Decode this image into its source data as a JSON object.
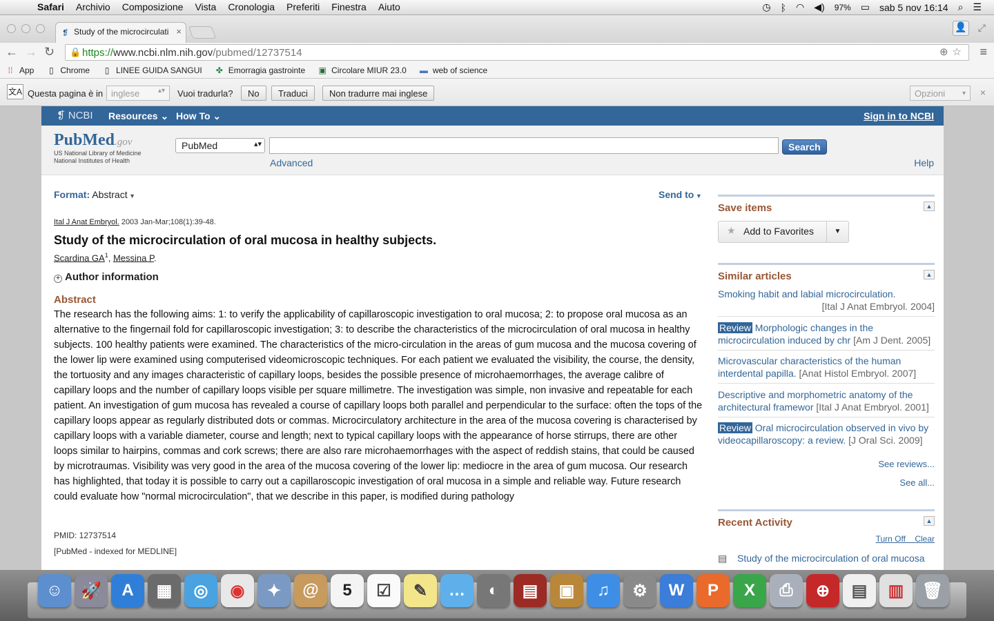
{
  "menubar": {
    "app": "Safari",
    "items": [
      "Archivio",
      "Composizione",
      "Vista",
      "Cronologia",
      "Preferiti",
      "Finestra",
      "Aiuto"
    ],
    "battery": "97%",
    "datetime": "sab 5 nov  16:14"
  },
  "browser": {
    "tab_title": "Study of the microcirculati",
    "url_scheme": "https://",
    "url_host": "www.ncbi.nlm.nih.gov",
    "url_path": "/pubmed/12737514"
  },
  "bookmarks": [
    {
      "label": "App",
      "icon": "apps-grid-icon"
    },
    {
      "label": "Chrome",
      "icon": "page-icon"
    },
    {
      "label": "LINEE GUIDA SANGUI",
      "icon": "page-icon"
    },
    {
      "label": "Emorragia gastrointe",
      "icon": "site-icon"
    },
    {
      "label": "Circolare MIUR 23.0",
      "icon": "site-icon"
    },
    {
      "label": "web of science",
      "icon": "folder-icon"
    }
  ],
  "translate": {
    "prefix": "Questa pagina è in",
    "language": "inglese",
    "question": "Vuoi tradurla?",
    "no": "No",
    "translate_btn": "Traduci",
    "never": "Non tradurre mai inglese",
    "options": "Opzioni"
  },
  "ncbi": {
    "logo": "NCBI",
    "resources": "Resources",
    "howto": "How To",
    "signin": "Sign in to NCBI"
  },
  "search": {
    "logo_main": "PubMed",
    "logo_gov": ".gov",
    "logo_sub1": "US National Library of Medicine",
    "logo_sub2": "National Institutes of Health",
    "db": "PubMed",
    "button": "Search",
    "advanced": "Advanced",
    "help": "Help"
  },
  "article": {
    "format_label": "Format:",
    "format_value": "Abstract",
    "send_to": "Send to",
    "journal": "Ital J Anat Embryol.",
    "citation": " 2003 Jan-Mar;108(1):39-48.",
    "title": "Study of the microcirculation of oral mucosa in healthy subjects.",
    "author1": "Scardina GA",
    "author1_sup": "1",
    "author2": "Messina P",
    "author_info": "Author information",
    "abstract_heading": "Abstract",
    "abstract": "The research has the following aims: 1: to verify the applicability of capillaroscopic investigation to oral mucosa; 2: to propose oral mucosa as an alternative to the fingernail fold for capillaroscopic investigation; 3: to describe the characteristics of the microcirculation of oral mucosa in healthy subjects. 100 healthy patients were examined. The characteristics of the micro-circulation in the areas of gum mucosa and the mucosa covering of the lower lip were examined using computerised videomicroscopic techniques. For each patient we evaluated the visibility, the course, the density, the tortuosity and any images characteristic of capillary loops, besides the possible presence of microhaemorrhages, the average calibre of capillary loops and the number of capillary loops visible per square millimetre. The investigation was simple, non invasive and repeatable for each patient. An investigation of gum mucosa has revealed a course of capillary loops both parallel and perpendicular to the surface: often the tops of the capillary loops appear as regularly distributed dots or commas. Microcirculatory architecture in the area of the mucosa covering is characterised by capillary loops with a variable diameter, course and length; next to typical capillary loops with the appearance of horse stirrups, there are other loops similar to hairpins, commas and cork screws; there are also rare microhaemorrhages with the aspect of reddish stains, that could be caused by microtraumas. Visibility was very good in the area of the mucosa covering of the lower lip: mediocre in the area of gum mucosa. Our research has highlighted, that today it is possible to carry out a capillaroscopic investigation of oral mucosa in a simple and reliable way. Future research could evaluate how \"normal microcirculation\", that we describe in this paper, is modified during pathology",
    "pmid": "PMID: 12737514",
    "indexed": "[PubMed - indexed for MEDLINE]"
  },
  "sidebar": {
    "save_heading": "Save items",
    "add_fav": "Add to Favorites",
    "similar_heading": "Similar articles",
    "similar": [
      {
        "badge": "",
        "title": "Smoking habit and labial microcirculation.",
        "source": "[Ital J Anat Embryol. 2004]"
      },
      {
        "badge": "Review",
        "title": " Morphologic changes in the microcirculation induced by chr",
        "source": "[Am J Dent. 2005]"
      },
      {
        "badge": "",
        "title": "Microvascular characteristics of the human interdental papilla.",
        "source": "[Anat Histol Embryol. 2007]"
      },
      {
        "badge": "",
        "title": "Descriptive and morphometric anatomy of the architectural framewor",
        "source": "[Ital J Anat Embryol. 2001]"
      },
      {
        "badge": "Review",
        "title": " Oral microcirculation observed in vivo by videocapillaroscopy: a review.",
        "source": "[J Oral Sci. 2009]"
      }
    ],
    "see_reviews": "See reviews...",
    "see_all": "See all...",
    "recent_heading": "Recent Activity",
    "turn_off": "Turn Off",
    "clear": "Clear",
    "recent_item": "Study of the microcirculation of oral mucosa"
  },
  "dock": [
    "finder-icon",
    "launchpad-icon",
    "app-store-icon",
    "photo-booth-icon",
    "safari-icon",
    "chrome-icon",
    "preview-icon",
    "contacts-icon",
    "calendar-icon",
    "reminders-icon",
    "notes-icon",
    "messages-icon",
    "facetime-icon",
    "photo-slideshow-icon",
    "iphoto-icon",
    "itunes-icon",
    "system-preferences-icon",
    "word-icon",
    "powerpoint-icon",
    "excel-icon",
    "printer-icon",
    "globe-icon",
    "document-icon",
    "preview-doc-icon",
    "trash-icon"
  ]
}
